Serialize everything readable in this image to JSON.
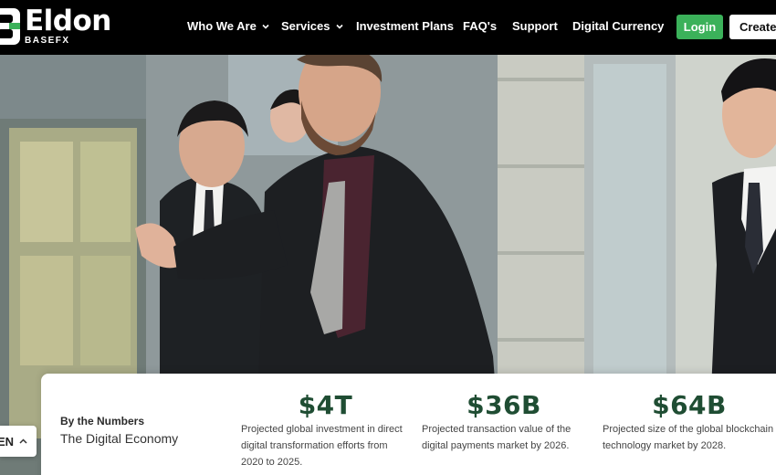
{
  "brand": {
    "name": "Eldon",
    "sub": "BASEFX",
    "accent": "#3bb15a",
    "dark_green": "#1f4d33"
  },
  "nav": {
    "items": [
      {
        "label": "Who We Are",
        "dropdown": true
      },
      {
        "label": "Services",
        "dropdown": true
      },
      {
        "label": "Investment Plans",
        "dropdown": false
      },
      {
        "label": "FAQ's",
        "dropdown": false
      },
      {
        "label": "Support",
        "dropdown": false
      },
      {
        "label": "Digital Currency",
        "dropdown": false
      }
    ],
    "login_label": "Login",
    "create_label": "Create A"
  },
  "stats": {
    "label": "By the Numbers",
    "subtitle": "The Digital Economy",
    "items": [
      {
        "value": "$4T",
        "desc": "Projected global investment in direct digital transformation efforts from 2020 to 2025."
      },
      {
        "value": "$36B",
        "desc": "Projected transaction value of the digital payments market by 2026."
      },
      {
        "value": "$64B",
        "desc": "Projected size of the global blockchain technology market by 2028."
      }
    ]
  },
  "language": {
    "code": "EN"
  }
}
